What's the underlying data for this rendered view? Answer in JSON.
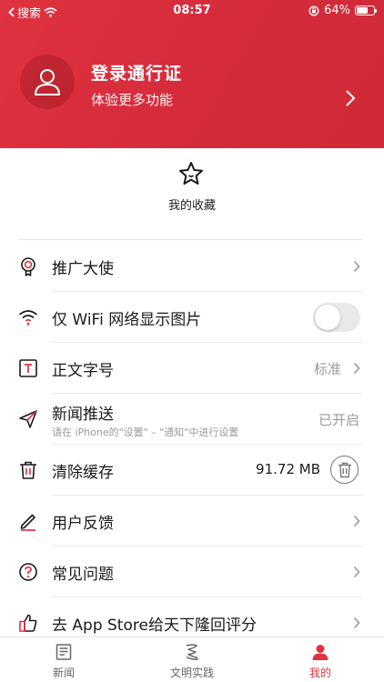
{
  "status_bar": {
    "back_label": "搜索",
    "time": "08:57",
    "battery": "64%",
    "battery_level": 0.64
  },
  "header": {
    "title": "登录通行证",
    "subtitle": "体验更多功能"
  },
  "favorites": {
    "label": "我的收藏"
  },
  "settings": [
    {
      "icon": "badge-icon",
      "title": "推广大使",
      "has_chevron": true
    },
    {
      "icon": "wifi-icon",
      "title": "仅 WiFi 网络显示图片",
      "toggle": false
    },
    {
      "icon": "font-size-icon",
      "title": "正文字号",
      "value": "标准",
      "has_chevron": true
    },
    {
      "icon": "send-icon",
      "title": "新闻推送",
      "subtitle": "请在 iPhone的\"设置\" – \"通知\"中进行设置",
      "value": "已开启"
    },
    {
      "icon": "trash-icon",
      "title": "清除缓存",
      "value": "91.72 MB"
    },
    {
      "icon": "pencil-icon",
      "title": "用户反馈",
      "has_chevron": true
    },
    {
      "icon": "question-icon",
      "title": "常见问题",
      "has_chevron": true
    },
    {
      "icon": "thumbs-up-icon",
      "title": "去 App Store给天下隆回评分",
      "has_chevron": true
    }
  ],
  "tabbar": {
    "tabs": [
      {
        "label": "新闻",
        "icon": "news-icon",
        "active": false
      },
      {
        "label": "文明实践",
        "icon": "civilization-icon",
        "active": false
      },
      {
        "label": "我的",
        "icon": "profile-icon",
        "active": true
      }
    ]
  },
  "colors": {
    "accent": "#e0323f",
    "header_bg": "#d52b3b"
  }
}
